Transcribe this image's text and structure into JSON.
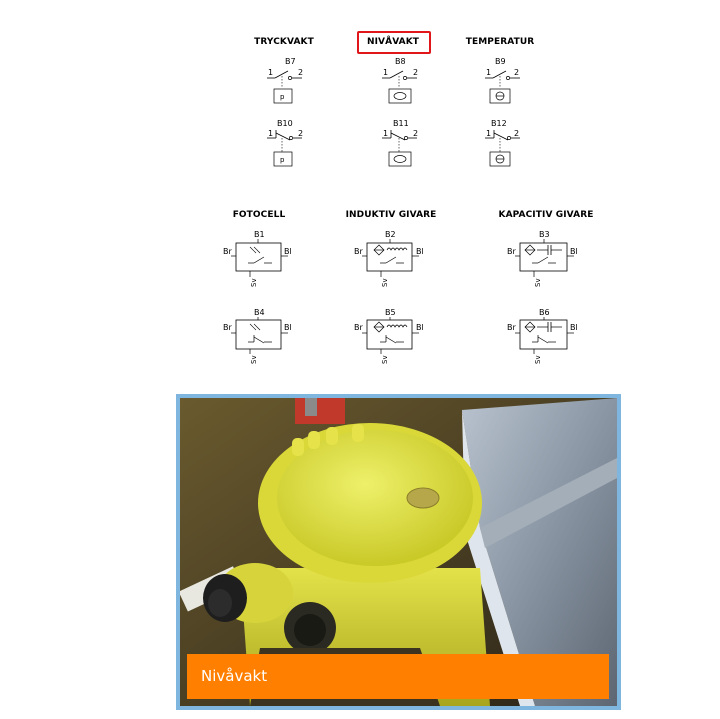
{
  "switch_categories": {
    "pressure": "TRYCKVAKT",
    "level": "NIVÅVAKT",
    "temperature": "TEMPERATUR"
  },
  "switches": {
    "B7": "B7",
    "B8": "B8",
    "B9": "B9",
    "B10": "B10",
    "B11": "B11",
    "B12": "B12"
  },
  "terminal_labels": {
    "one": "1",
    "two": "2"
  },
  "pressure_symbol": "p",
  "sensor_categories": {
    "photocell": "FOTOCELL",
    "inductive": "INDUKTIV GIVARE",
    "capacitive": "KAPACITIV GIVARE"
  },
  "sensors": {
    "B1": "B1",
    "B2": "B2",
    "B3": "B3",
    "B4": "B4",
    "B5": "B5",
    "B6": "B6"
  },
  "wire_labels": {
    "brown": "Br",
    "blue": "Bl",
    "black": "Sv"
  },
  "highlight_color": "#e0161a",
  "photo": {
    "caption": "Nivåvakt",
    "caption_bg": "#ff7f00",
    "frame_color": "#7fb6df",
    "description_icon": "yellow-level-switch-photo"
  }
}
